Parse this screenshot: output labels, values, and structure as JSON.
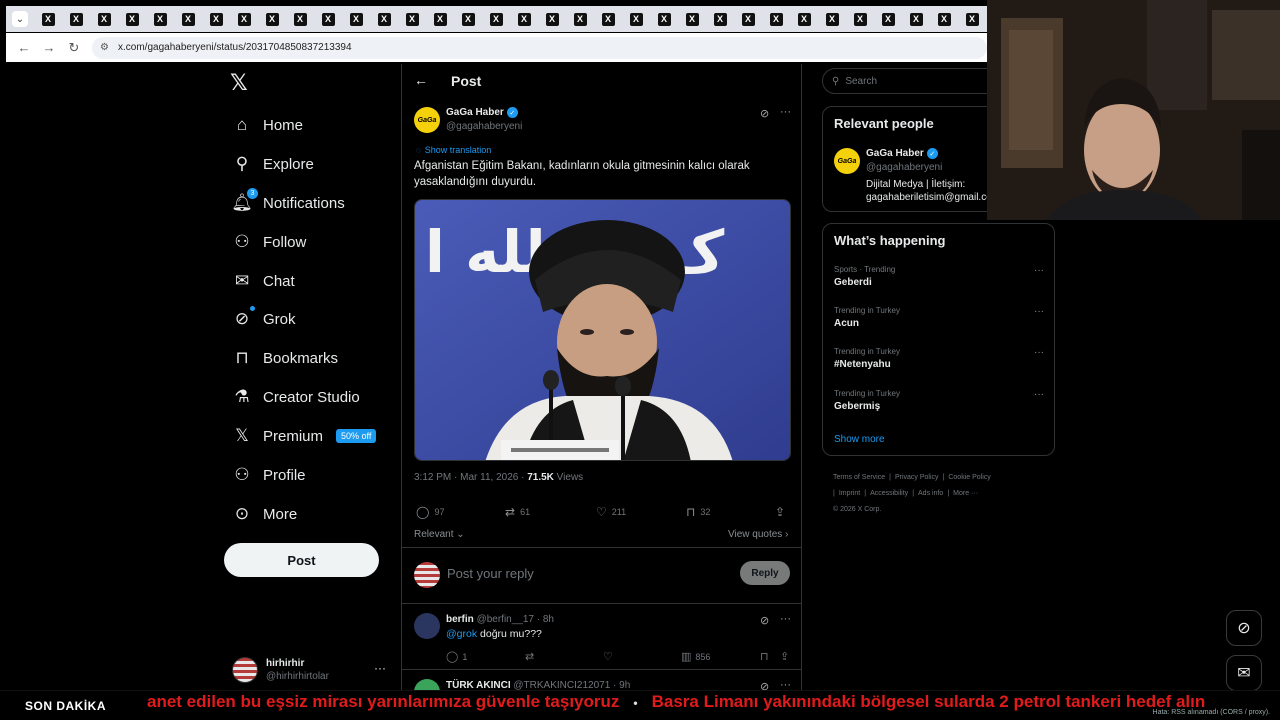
{
  "browser": {
    "tab_count": 34,
    "tab_icon": "x-logo-icon",
    "tab_glyph": "X",
    "url": "x.com/gagahaberyeni/status/2031704850837213394"
  },
  "nav": {
    "items": [
      {
        "key": "home",
        "label": "Home",
        "icon": "home-icon"
      },
      {
        "key": "explore",
        "label": "Explore",
        "icon": "search-icon"
      },
      {
        "key": "notifications",
        "label": "Notifications",
        "icon": "bell-icon",
        "badge": "3"
      },
      {
        "key": "follow",
        "label": "Follow",
        "icon": "add-user-icon"
      },
      {
        "key": "chat",
        "label": "Chat",
        "icon": "mail-icon"
      },
      {
        "key": "grok",
        "label": "Grok",
        "icon": "grok-icon"
      },
      {
        "key": "bookmarks",
        "label": "Bookmarks",
        "icon": "bookmark-icon"
      },
      {
        "key": "creator-studio",
        "label": "Creator Studio",
        "icon": "flask-icon"
      },
      {
        "key": "premium",
        "label": "Premium",
        "icon": "x-icon",
        "badge": "50% off"
      },
      {
        "key": "profile",
        "label": "Profile",
        "icon": "user-icon"
      },
      {
        "key": "more",
        "label": "More",
        "icon": "more-circle-icon"
      }
    ],
    "post_button": "Post"
  },
  "account": {
    "name": "hirhirhir",
    "handle": "@hirhirhirtolar"
  },
  "main": {
    "title": "Post",
    "author": {
      "name": "GaGa Haber",
      "handle": "@gagahaberyeni",
      "avatar_text": "GaGa"
    },
    "show_translation": "Show translation",
    "text": "Afganistan Eğitim Bakanı, kadınların okula gitmesinin kalıcı olarak yasaklandığını duyurdu.",
    "image_banner_text": "ک سا لله ا",
    "timestamp": "3:12 PM · Mar 11, 2026 · ",
    "views_count": "71.5K",
    "views_label": " Views",
    "actions": {
      "replies": "97",
      "reposts": "61",
      "likes": "211",
      "bookmarks": "32"
    },
    "sort_label": "Relevant ⌄",
    "view_quotes": "View quotes ›",
    "reply_placeholder": "Post your reply",
    "reply_button": "Reply",
    "replies": [
      {
        "name": "berfin",
        "meta": "@berfin__17 · 8h",
        "mention": "@grok",
        "text": " doğru mu???",
        "replies": "1",
        "reposts": "",
        "likes": "",
        "views": "856"
      },
      {
        "name": "TÜRK AKINCI",
        "meta": "@TRKAKINCI212071 · 9h",
        "mention": "",
        "text": "",
        "replies": "",
        "reposts": "",
        "likes": "",
        "views": ""
      }
    ]
  },
  "right": {
    "search_placeholder": "Search",
    "relevant_title": "Relevant people",
    "relevant_person": {
      "name": "GaGa Haber",
      "handle": "@gagahaberyeni",
      "bio_line1": "Dijital Medya | İletişim:",
      "bio_line2": "gagahaberiletisim@gmail.com"
    },
    "happening_title": "What’s happening",
    "trends": [
      {
        "context": "Sports · Trending",
        "name": "Geberdi"
      },
      {
        "context": "Trending in Turkey",
        "name": "Acun"
      },
      {
        "context": "Trending in Turkey",
        "name": "#Netenyahu"
      },
      {
        "context": "Trending in Turkey",
        "name": "Gebermiş"
      }
    ],
    "show_more": "Show more",
    "footer": [
      "Terms of Service",
      "|",
      "Privacy Policy",
      "|",
      "Cookie Policy",
      "|",
      "Imprint",
      "|",
      "Accessibility",
      "|",
      "Ads info",
      "|",
      "More ···",
      "© 2026 X Corp."
    ]
  },
  "ticker": {
    "label": "SON DAKİKA",
    "text_1": "anet edilen bu eşsiz mirası yarınlarımıza güvenle taşıyoruz",
    "separator": "•",
    "text_2": "Basra Limanı yakınındaki bölgesel sularda 2 petrol tankeri hedef alın",
    "status": "Hata: RSS alınamadı (CORS / proxy)."
  },
  "colors": {
    "accent": "#1d9bf0",
    "ticker_red": "#e11b1b",
    "avatar_yellow": "#f5d10b"
  }
}
